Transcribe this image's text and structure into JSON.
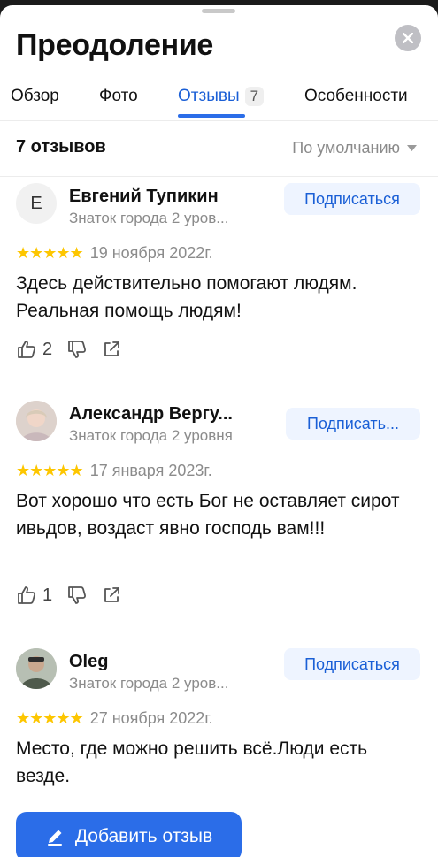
{
  "header": {
    "title": "Преодоление"
  },
  "tabs": [
    {
      "label": "Обзор"
    },
    {
      "label": "Фото"
    },
    {
      "label": "Отзывы",
      "count": "7"
    },
    {
      "label": "Особенности"
    }
  ],
  "reviews_section": {
    "count_label": "7 отзывов",
    "sort_label": "По умолчанию"
  },
  "reviews": [
    {
      "avatar_letter": "Е",
      "name": "Евгений Тупикин",
      "level": "Знаток города 2 уров...",
      "subscribe_label": "Подписаться",
      "stars": "★★★★★",
      "date": "19 ноября 2022г.",
      "text": "Здесь действительно помогают людям. Реальная помощь людям!",
      "likes": "2"
    },
    {
      "name": "Александр Вергу...",
      "level": "Знаток города 2 уровня",
      "subscribe_label": "Подписать...",
      "stars": "★★★★★",
      "date": "17 января 2023г.",
      "text": "Вот хорошо что есть Бог не оставляет сирот ивьдов, воздаст явно господь вам!!!",
      "likes": "1"
    },
    {
      "name": "Oleg",
      "level": "Знаток города 2 уров...",
      "subscribe_label": "Подписаться",
      "stars": "★★★★★",
      "date": "27 ноября 2022г.",
      "text": "Место, где можно решить всё.Люди есть везде."
    }
  ],
  "footer": {
    "add_review_label": "Добавить отзыв"
  },
  "colors": {
    "accent": "#2b6de8",
    "star": "#fdc600",
    "subscribe_bg": "#eef4ff"
  },
  "icons": [
    "close-icon",
    "chevron-down-icon",
    "like-icon",
    "dislike-icon",
    "share-icon",
    "pencil-icon"
  ]
}
